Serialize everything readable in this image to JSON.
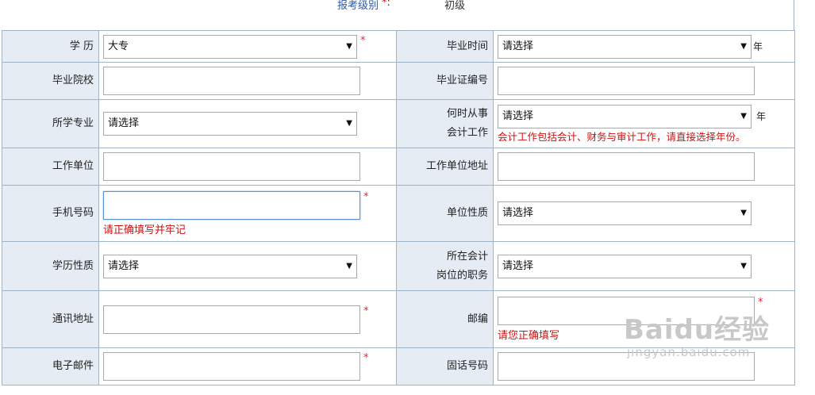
{
  "top": {
    "label": "报考级别",
    "required_mark": "*:",
    "value": "初级"
  },
  "fields": {
    "education": {
      "label": "学 历",
      "value": "大专"
    },
    "grad_time": {
      "label": "毕业时间",
      "value": "请选择",
      "unit": "年"
    },
    "school": {
      "label": "毕业院校",
      "value": ""
    },
    "cert_no": {
      "label": "毕业证编号",
      "value": ""
    },
    "major": {
      "label": "所学专业",
      "value": "请选择"
    },
    "work_since": {
      "label_line1": "何时从事",
      "label_line2": "会计工作",
      "value": "请选择",
      "unit": "年",
      "hint": "会计工作包括会计、财务与审计工作，请直接选择年份。"
    },
    "employer": {
      "label": "工作单位",
      "value": ""
    },
    "employer_addr": {
      "label": "工作单位地址",
      "value": ""
    },
    "mobile": {
      "label": "手机号码",
      "value": "",
      "hint": "请正确填写并牢记"
    },
    "org_type": {
      "label": "单位性质",
      "value": "请选择"
    },
    "edu_type": {
      "label": "学历性质",
      "value": "请选择"
    },
    "position": {
      "label_line1": "所在会计",
      "label_line2": "岗位的职务",
      "value": "请选择"
    },
    "address": {
      "label": "通讯地址",
      "value": ""
    },
    "postcode": {
      "label": "邮编",
      "value": "",
      "hint": "请您正确填写"
    },
    "email": {
      "label": "电子邮件",
      "value": ""
    },
    "phone": {
      "label": "固话号码",
      "value": ""
    }
  },
  "required_mark": "*",
  "watermark": {
    "logo": "Baidu经验",
    "url": "jingyan.baidu.com"
  }
}
